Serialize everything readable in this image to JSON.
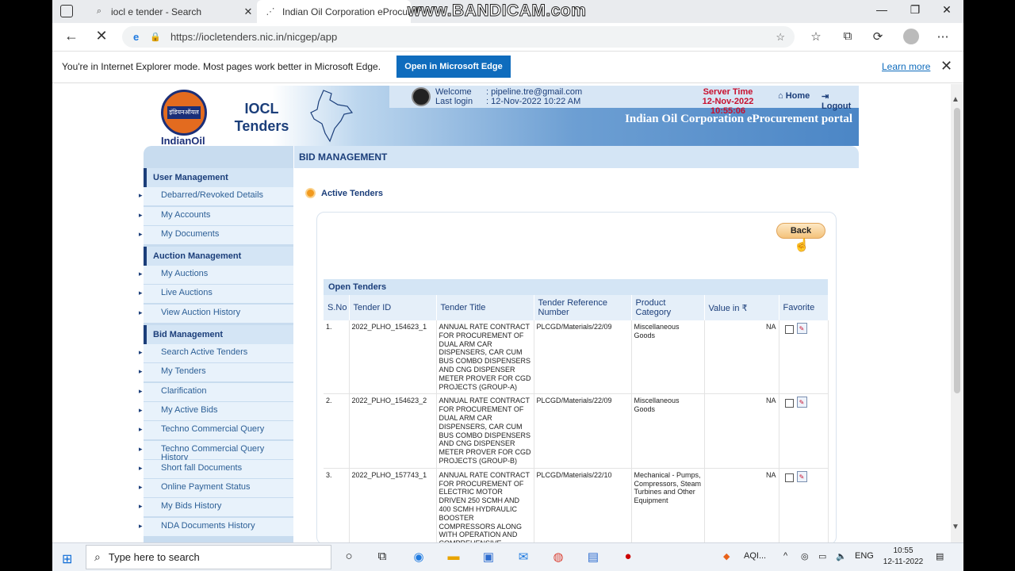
{
  "browser": {
    "tabs": [
      {
        "title": "iocl e tender - Search",
        "icon": "search-icon"
      },
      {
        "title": "Indian Oil Corporation eProcurem",
        "icon": "loading-icon"
      }
    ],
    "watermark": "www.BANDICAM.com",
    "url": "https://iocletenders.nic.in/nicgep/app",
    "ie_bar": {
      "message": "You're in Internet Explorer mode. Most pages work better in Microsoft Edge.",
      "open_button": "Open in Microsoft Edge",
      "learn_more": "Learn more"
    }
  },
  "header": {
    "logo_hindi": "इंडियनऑयल",
    "logo_text": "IndianOil",
    "brand_line1": "IOCL",
    "brand_line2": "Tenders",
    "welcome_label": "Welcome",
    "welcome_value": ": pipeline.tre@gmail.com",
    "last_login_label": "Last login",
    "last_login_value": ": 12-Nov-2022 10:22 AM",
    "server_time_label": "Server Time",
    "server_time_value": "12-Nov-2022 10:55:06",
    "home": "Home",
    "logout": "Logout",
    "portal_title": "Indian Oil Corporation eProcurement portal"
  },
  "sidebar": {
    "sections": [
      {
        "title": "User Management",
        "items": [
          "Debarred/Revoked Details",
          "My Accounts",
          "My Documents"
        ]
      },
      {
        "title": "Auction Management",
        "items": [
          "My Auctions",
          "Live Auctions",
          "View Auction History"
        ]
      },
      {
        "title": "Bid Management",
        "items": [
          "Search Active Tenders",
          "My Tenders",
          "Clarification",
          "My Active Bids",
          "Techno Commercial Query",
          "Techno Commercial Query History",
          "Short fall Documents",
          "Online Payment Status",
          "My Bids History",
          "NDA Documents History"
        ]
      }
    ]
  },
  "main": {
    "title": "BID MANAGEMENT",
    "section": "Active Tenders",
    "back_button": "Back",
    "table_title": "Open Tenders",
    "columns": [
      "S.No",
      "Tender ID",
      "Tender Title",
      "Tender Reference Number",
      "Product Category",
      "Value in ₹",
      "Favorite"
    ],
    "rows": [
      {
        "sno": "1.",
        "id": "2022_PLHO_154623_1",
        "title": "ANNUAL RATE CONTRACT FOR PROCUREMENT OF DUAL ARM CAR DISPENSERS, CAR CUM BUS COMBO DISPENSERS AND CNG DISPENSER METER PROVER FOR CGD PROJECTS (GROUP-A)",
        "ref": "PLCGD/Materials/22/09",
        "category": "Miscellaneous Goods",
        "value": "NA"
      },
      {
        "sno": "2.",
        "id": "2022_PLHO_154623_2",
        "title": "ANNUAL RATE CONTRACT FOR PROCUREMENT OF DUAL ARM CAR DISPENSERS, CAR CUM BUS COMBO DISPENSERS AND CNG DISPENSER METER PROVER FOR CGD PROJECTS (GROUP-B)",
        "ref": "PLCGD/Materials/22/09",
        "category": "Miscellaneous Goods",
        "value": "NA"
      },
      {
        "sno": "3.",
        "id": "2022_PLHO_157743_1",
        "title": "ANNUAL RATE CONTRACT FOR PROCUREMENT OF ELECTRIC MOTOR DRIVEN 250 SCMH AND 400 SCMH HYDRAULIC BOOSTER COMPRESSORS ALONG WITH OPERATION AND COMPREHENSIVE",
        "ref": "PLCGD/Materials/22/10",
        "category": "Mechanical - Pumps, Compressors, Steam Turbines and Other Equipment",
        "value": "NA"
      }
    ]
  },
  "taskbar": {
    "search_placeholder": "Type here to search",
    "weather": "AQI...",
    "language": "ENG",
    "time": "10:55",
    "date": "12-11-2022"
  },
  "colors": {
    "brand_blue": "#1b3e7a",
    "accent_orange": "#e36b1f",
    "edge_blue": "#0f6cbd"
  }
}
